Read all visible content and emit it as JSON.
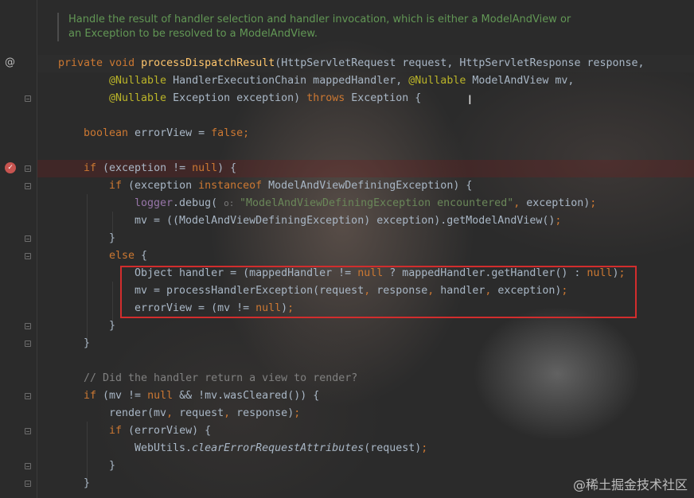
{
  "doc_comment": {
    "line1": "Handle the result of handler selection and handler invocation, which is either a ModelAndView or",
    "line2": "an Exception to be resolved to a ModelAndView."
  },
  "gutter": {
    "override_icon": "override-icon",
    "override_glyph": "@",
    "breakpoint_icon": "breakpoint-icon",
    "breakpoint_glyph": "✓"
  },
  "code": {
    "l1_private": "private",
    "l1_void": "void",
    "l1_method": "processDispatchResult",
    "l1_rest": "(HttpServletRequest request, HttpServletResponse response,",
    "l2_ann1": "@Nullable",
    "l2_mid": " HandlerExecutionChain mappedHandler, ",
    "l2_ann2": "@Nullable",
    "l2_rest": " ModelAndView mv,",
    "l3_ann": "@Nullable",
    "l3_mid": " Exception exception) ",
    "l3_throws": "throws",
    "l3_rest": " Exception {",
    "l4_type": "boolean",
    "l4_mid": " errorView = ",
    "l4_false": "false",
    "l4_semi": ";",
    "l5_if": "if",
    "l5_mid": " (exception != ",
    "l5_null": "null",
    "l5_rest": ") {",
    "l6_if": "if",
    "l6_mid": " (exception ",
    "l6_instanceof": "instanceof",
    "l6_rest": " ModelAndViewDefiningException) {",
    "l7_logger": "logger",
    "l7_mid": ".debug( ",
    "l7_hint": "o: ",
    "l7_str": "\"ModelAndViewDefiningException encountered\"",
    "l7_comma": ",",
    "l7_rest": " exception)",
    "l7_semi": ";",
    "l8_text": "mv = ((ModelAndViewDefiningException) exception).getModelAndView()",
    "l8_semi": ";",
    "l9_brace": "}",
    "l10_else": "else",
    "l10_rest": " {",
    "l11_a": "Object handler = (mappedHandler != ",
    "l11_null1": "null",
    "l11_b": " ? mappedHandler.getHandler() : ",
    "l11_null2": "null",
    "l11_c": ")",
    "l11_semi": ";",
    "l12_a": "mv = processHandlerException(request",
    "l12_c1": ",",
    "l12_b": " response",
    "l12_c2": ",",
    "l12_c": " handler",
    "l12_c3": ",",
    "l12_d": " exception)",
    "l12_semi": ";",
    "l13_a": "errorView = (mv != ",
    "l13_null": "null",
    "l13_b": ")",
    "l13_semi": ";",
    "l14_brace": "}",
    "l15_brace": "}",
    "l16_comment": "// Did the handler return a view to render?",
    "l17_if": "if",
    "l17_a": " (mv != ",
    "l17_null": "null",
    "l17_b": " && !mv.wasCleared()) {",
    "l18_a": "render(mv",
    "l18_c1": ",",
    "l18_b": " request",
    "l18_c2": ",",
    "l18_c": " response)",
    "l18_semi": ";",
    "l19_if": "if",
    "l19_rest": " (errorView) {",
    "l20_a": "WebUtils.",
    "l20_method": "clearErrorRequestAttributes",
    "l20_b": "(request)",
    "l20_semi": ";",
    "l21_brace": "}",
    "l22_brace": "}"
  },
  "watermark": "@稀土掘金技术社区",
  "colors": {
    "background": "#2b2b2b",
    "keyword": "#cc7832",
    "method": "#ffc66d",
    "annotation": "#bbb529",
    "field": "#9876aa",
    "string": "#6a8759",
    "comment": "#808080",
    "doc_comment": "#629755",
    "highlight_box": "#d22d2d"
  }
}
